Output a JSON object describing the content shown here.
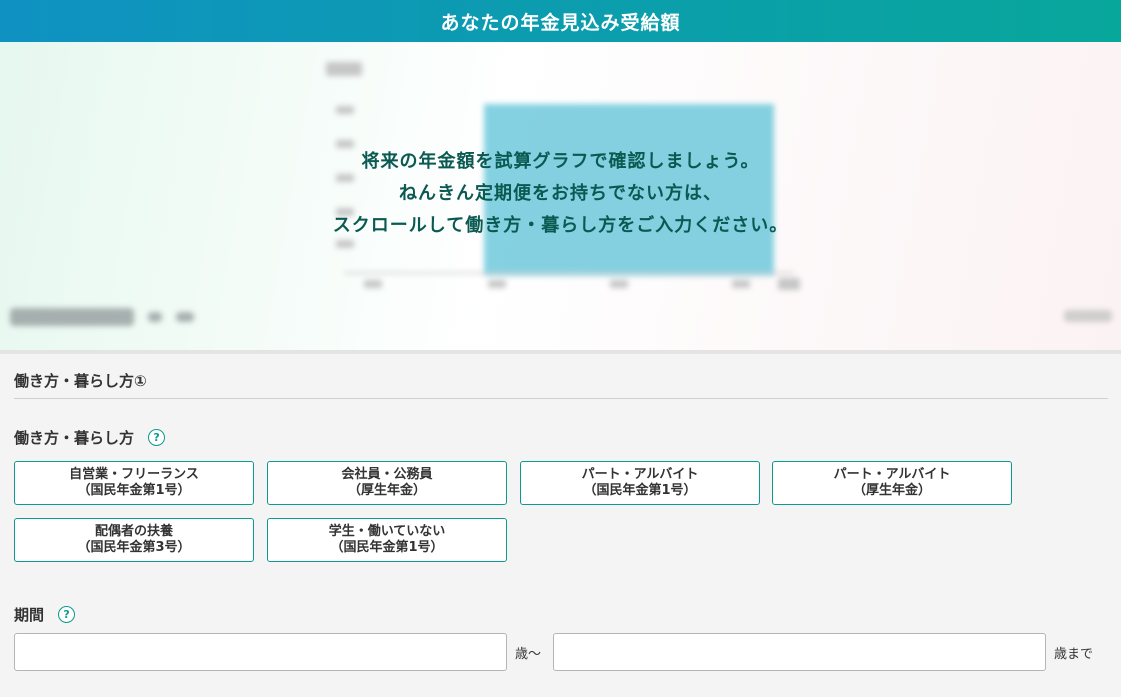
{
  "header": {
    "title": "あなたの年金見込み受給額"
  },
  "graph": {
    "bar_color": "#6fc9dc",
    "message_lines": [
      "将来の年金額を試算グラフで確認しましょう。",
      "ねんきん定期便をお持ちでない方は、",
      "スクロールして働き方・暮らし方をご入力ください。"
    ]
  },
  "form": {
    "section_title": "働き方・暮らし方①",
    "work_style": {
      "label": "働き方・暮らし方",
      "help_icon": "question-circle-icon",
      "options": [
        {
          "line1": "自営業・フリーランス",
          "line2": "（国民年金第1号）"
        },
        {
          "line1": "会社員・公務員",
          "line2": "（厚生年金）"
        },
        {
          "line1": "パート・アルバイト",
          "line2": "（国民年金第1号）"
        },
        {
          "line1": "パート・アルバイト",
          "line2": "（厚生年金）"
        },
        {
          "line1": "配偶者の扶養",
          "line2": "（国民年金第3号）"
        },
        {
          "line1": "学生・働いていない",
          "line2": "（国民年金第1号）"
        }
      ]
    },
    "period": {
      "label": "期間",
      "help_icon": "question-circle-icon",
      "from_value": "",
      "from_suffix": "歳〜",
      "to_value": "",
      "to_suffix": "歳まで"
    }
  },
  "colors": {
    "accent": "#0b9a8f",
    "header_start": "#0f92c2",
    "header_end": "#08a79b"
  }
}
